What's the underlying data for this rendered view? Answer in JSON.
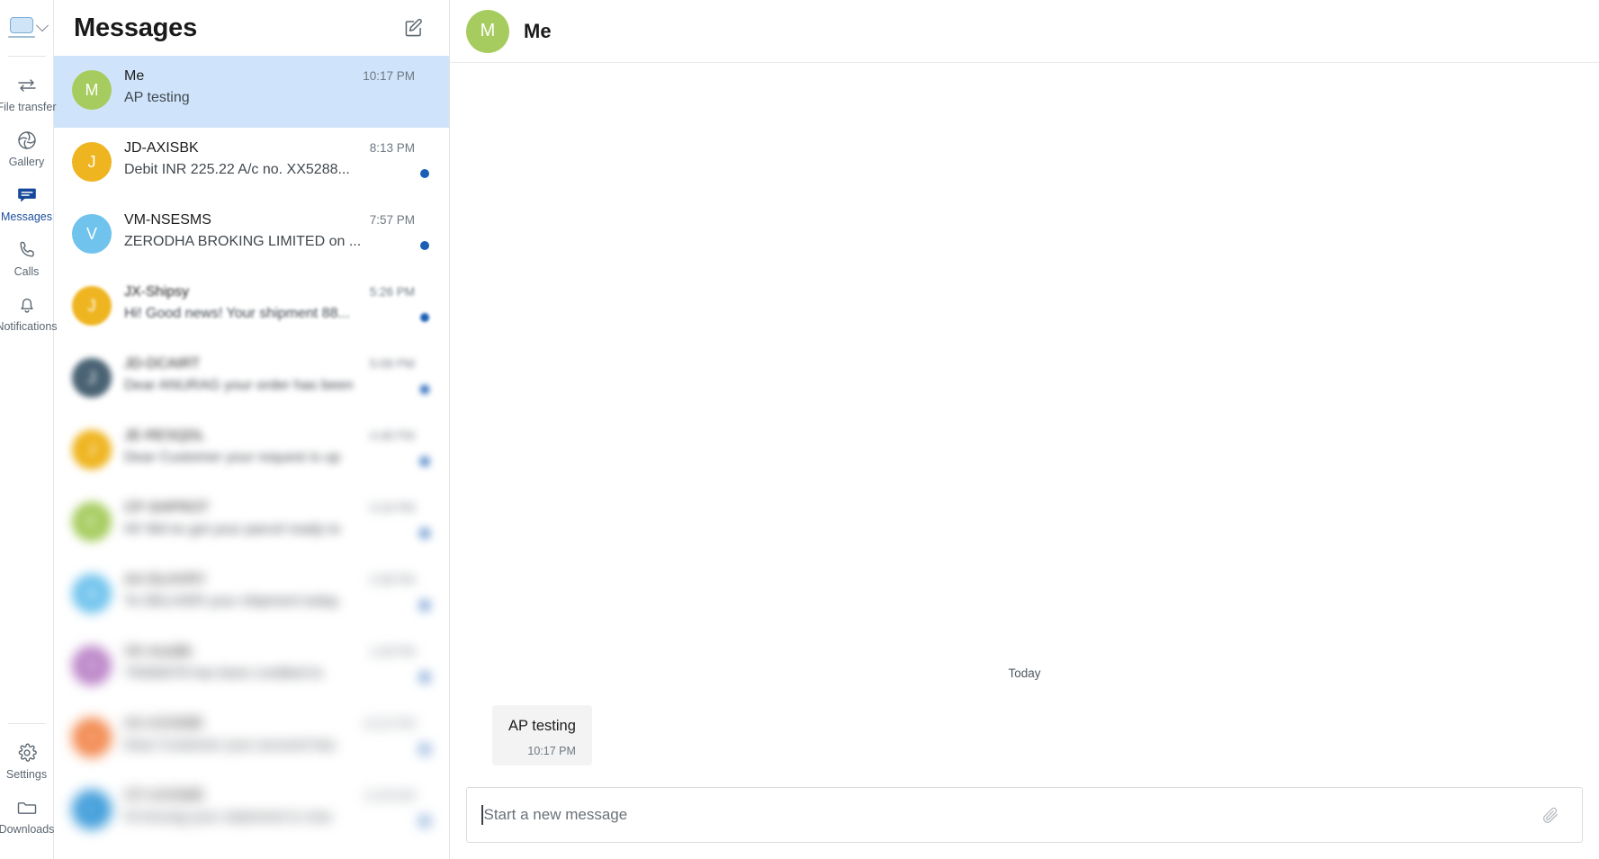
{
  "rail": {
    "device_selector": {
      "icon": "laptop-icon",
      "chevron": "chevron-down-icon"
    },
    "items": [
      {
        "label": "File transfer",
        "icon": "file-transfer-icon",
        "active": false
      },
      {
        "label": "Gallery",
        "icon": "gallery-icon",
        "active": false
      },
      {
        "label": "Messages",
        "icon": "messages-icon",
        "active": true
      },
      {
        "label": "Calls",
        "icon": "phone-icon",
        "active": false
      },
      {
        "label": "Notifications",
        "icon": "bell-icon",
        "active": false
      }
    ],
    "bottom_items": [
      {
        "label": "Settings",
        "icon": "gear-icon"
      },
      {
        "label": "Downloads",
        "icon": "folder-icon"
      }
    ]
  },
  "list": {
    "title": "Messages",
    "compose_icon": "compose-icon",
    "conversations": [
      {
        "initial": "M",
        "color": "#a6cc5f",
        "name": "Me",
        "time": "10:17 PM",
        "preview": "AP testing",
        "unread": false,
        "selected": true,
        "blur": 0
      },
      {
        "initial": "J",
        "color": "#efb521",
        "name": "JD-AXISBK",
        "time": "8:13 PM",
        "preview": "Debit INR 225.22 A/c no. XX5288...",
        "unread": true,
        "selected": false,
        "blur": 0
      },
      {
        "initial": "V",
        "color": "#6fc3ed",
        "name": "VM-NSESMS",
        "time": "7:57 PM",
        "preview": "ZERODHA BROKING LIMITED on ...",
        "unread": true,
        "selected": false,
        "blur": 0
      },
      {
        "initial": "J",
        "color": "#efb521",
        "name": "JX-Shipsy",
        "time": "5:26 PM",
        "preview": "Hi! Good news! Your shipment 88...",
        "unread": true,
        "selected": false,
        "blur": 1.6
      },
      {
        "initial": "J",
        "color": "#4a6374",
        "name": "JD-DCAIRT",
        "time": "5:09 PM",
        "preview": "Dear ANURAG your order has been",
        "unread": true,
        "selected": false,
        "blur": 3.4
      },
      {
        "initial": "J",
        "color": "#efb521",
        "name": "JE-RESQDL",
        "time": "4:48 PM",
        "preview": "Dear Customer your request is up",
        "unread": true,
        "selected": false,
        "blur": 4.6
      },
      {
        "initial": "C",
        "color": "#a6cc5f",
        "name": "CP-SHPROT",
        "time": "3:19 PM",
        "preview": "Hi! We've got your parcel ready to",
        "unread": true,
        "selected": false,
        "blur": 5.4
      },
      {
        "initial": "A",
        "color": "#6fc3ed",
        "name": "AX-DLHVRY",
        "time": "2:38 PM",
        "preview": "To DELIVER your shipment today",
        "unread": true,
        "selected": false,
        "blur": 6.0
      },
      {
        "initial": "V",
        "color": "#bb85c8",
        "name": "VK-AxisBk",
        "time": "1:49 PM",
        "preview": "75000078 has been credited to",
        "unread": true,
        "selected": false,
        "blur": 6.4
      },
      {
        "initial": "A",
        "color": "#f2864b",
        "name": "AX-AXISMB",
        "time": "12:22 PM",
        "preview": "Dear Customer your account has",
        "unread": true,
        "selected": false,
        "blur": 6.8
      },
      {
        "initial": "C",
        "color": "#3a9ad9",
        "name": "CP-AXISMB",
        "time": "11:05 AM",
        "preview": "Hi Anurag your statement is now",
        "unread": true,
        "selected": false,
        "blur": 7.2
      }
    ]
  },
  "conversation": {
    "header": {
      "initial": "M",
      "color": "#a6cc5f",
      "name": "Me"
    },
    "day_separator": "Today",
    "messages": [
      {
        "text": "AP testing",
        "time": "10:17 PM",
        "outgoing": false
      }
    ],
    "composer": {
      "placeholder": "Start a new message",
      "value": "",
      "attach_icon": "paperclip-icon"
    }
  },
  "colors": {
    "accent": "#1b5fb4",
    "selected_row": "#cfe4fb",
    "bubble": "#f3f3f4"
  }
}
